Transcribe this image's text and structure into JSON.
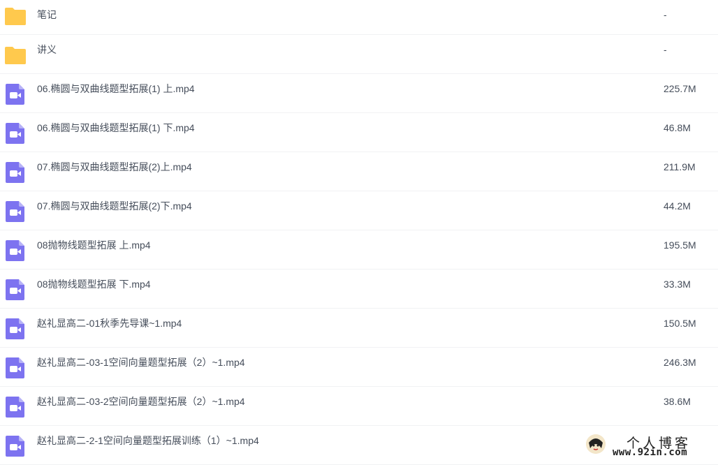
{
  "files": [
    {
      "name": "笔记",
      "size": "-",
      "type": "folder",
      "icon": "folder-icon"
    },
    {
      "name": "讲义",
      "size": "-",
      "type": "folder",
      "icon": "folder-icon"
    },
    {
      "name": "06.椭圆与双曲线题型拓展(1) 上.mp4",
      "size": "225.7M",
      "type": "video",
      "icon": "video-icon"
    },
    {
      "name": "06.椭圆与双曲线题型拓展(1) 下.mp4",
      "size": "46.8M",
      "type": "video",
      "icon": "video-icon"
    },
    {
      "name": "07.椭圆与双曲线题型拓展(2)上.mp4",
      "size": "211.9M",
      "type": "video",
      "icon": "video-icon"
    },
    {
      "name": "07.椭圆与双曲线题型拓展(2)下.mp4",
      "size": "44.2M",
      "type": "video",
      "icon": "video-icon"
    },
    {
      "name": "08抛物线题型拓展 上.mp4",
      "size": "195.5M",
      "type": "video",
      "icon": "video-icon"
    },
    {
      "name": "08抛物线题型拓展 下.mp4",
      "size": "33.3M",
      "type": "video",
      "icon": "video-icon"
    },
    {
      "name": "赵礼显高二-01秋季先导课~1.mp4",
      "size": "150.5M",
      "type": "video",
      "icon": "video-icon"
    },
    {
      "name": "赵礼显高二-03-1空间向量题型拓展（2）~1.mp4",
      "size": "246.3M",
      "type": "video",
      "icon": "video-icon"
    },
    {
      "name": "赵礼显高二-03-2空间向量题型拓展（2）~1.mp4",
      "size": "38.6M",
      "type": "video",
      "icon": "video-icon"
    },
    {
      "name": "赵礼显高二-2-1空间向量题型拓展训练（1）~1.mp4",
      "size": "",
      "type": "video",
      "icon": "video-icon"
    }
  ],
  "watermark": {
    "title": "个人博客",
    "url": "www.92in.com",
    "icon": "avatar-icon"
  },
  "colors": {
    "folder": "#ffc94d",
    "video": "#7d73f0",
    "text": "#454d5a",
    "divider": "#f1f2f4"
  }
}
